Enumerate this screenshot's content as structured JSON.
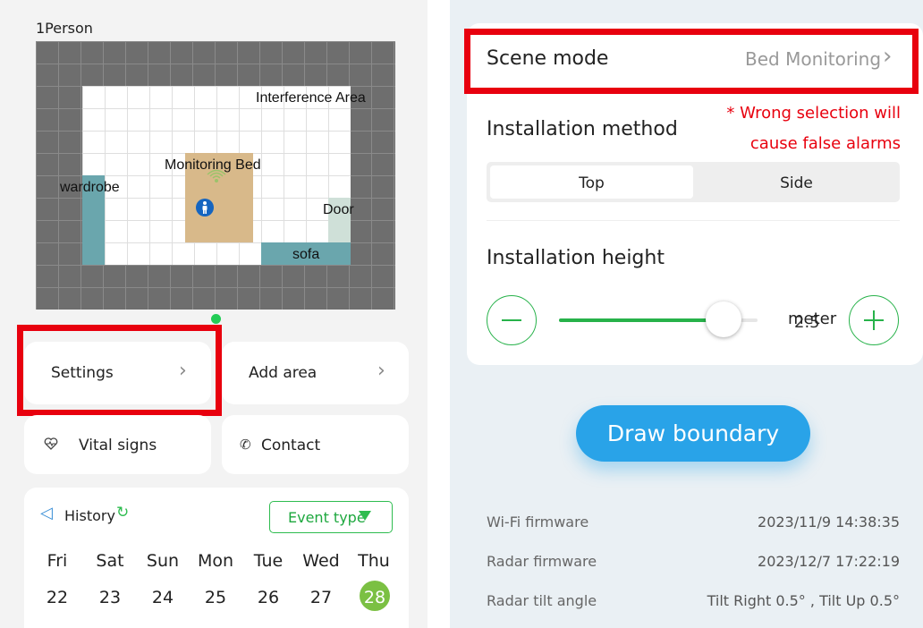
{
  "device": {
    "title": "1Person"
  },
  "map": {
    "interference_label": "Interference Area",
    "bed_label": "Monitoring Bed",
    "wardrobe_label": "wardrobe",
    "door_label": "Door",
    "sofa_label": "sofa",
    "colors": {
      "bed": "#d8b98a",
      "furniture": "#6aa6ad",
      "door": "#cfe0d8",
      "grid": "#6e6e6e"
    }
  },
  "menu": {
    "settings_label": "Settings",
    "add_area_label": "Add area",
    "vital_signs_label": "Vital signs",
    "contact_label": "Contact"
  },
  "history": {
    "title": "History",
    "event_type_label": "Event type",
    "days": [
      {
        "name": "Fri",
        "date": "22"
      },
      {
        "name": "Sat",
        "date": "23"
      },
      {
        "name": "Sun",
        "date": "24"
      },
      {
        "name": "Mon",
        "date": "25"
      },
      {
        "name": "Tue",
        "date": "26"
      },
      {
        "name": "Wed",
        "date": "27"
      },
      {
        "name": "Thu",
        "date": "28"
      }
    ],
    "selected_color": "#7bc043"
  },
  "settings": {
    "scene_mode_label": "Scene mode",
    "scene_mode_value": "Bed Monitoring",
    "installation_method_label": "Installation method",
    "warning_line1": "* Wrong selection will",
    "warning_line2": "cause false alarms",
    "method_top": "Top",
    "method_side": "Side",
    "installation_height_label": "Installation height",
    "height_value": "2.5",
    "height_unit": "meter",
    "height_level": 0.83,
    "draw_boundary_label": "Draw boundary",
    "accent_color": "#29a3e8",
    "slider_color": "#27b24a",
    "warning_color": "#e8000e"
  },
  "info": {
    "wifi_label": "Wi-Fi firmware",
    "wifi_value": "2023/11/9 14:38:35",
    "radar_label": "Radar firmware",
    "radar_value": "2023/12/7 17:22:19",
    "tilt_label": "Radar tilt angle",
    "tilt_value": "Tilt Right 0.5° , Tilt Up 0.5°"
  }
}
